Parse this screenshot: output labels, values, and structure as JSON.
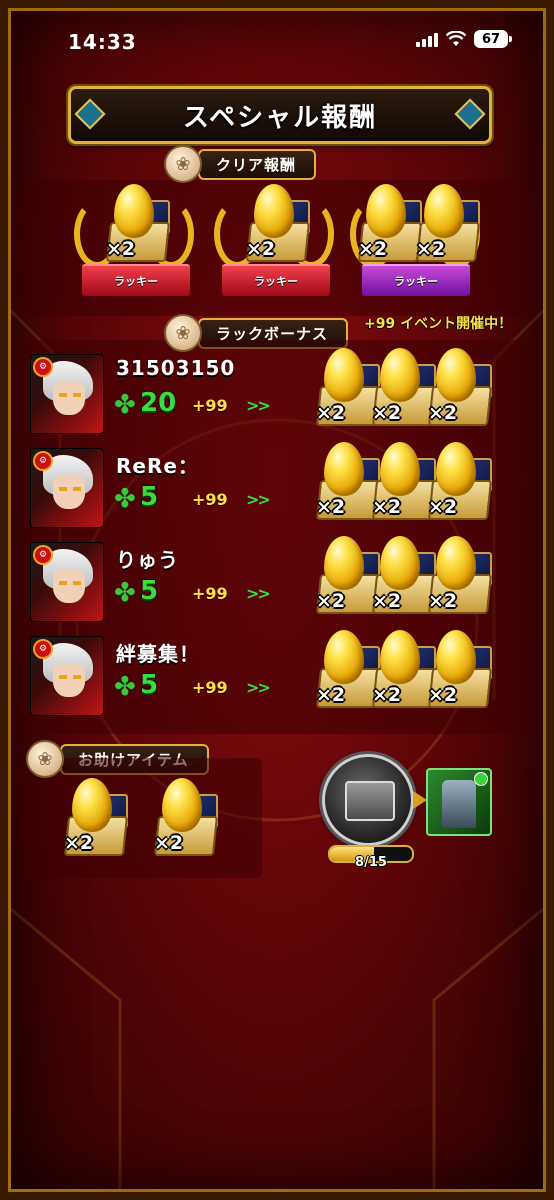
{
  "status_bar": {
    "time": "14:33",
    "battery": "67"
  },
  "title": "スペシャル報酬",
  "clear_reward": {
    "label": "クリア報酬",
    "groups": [
      {
        "ribbon": "ラッキー",
        "ribbon_color": "#c8102e",
        "counts": [
          "×2"
        ]
      },
      {
        "ribbon": "ラッキー",
        "ribbon_color": "#c8102e",
        "counts": [
          "×2"
        ]
      },
      {
        "ribbon": "ラッキー",
        "ribbon_color": "#9c1fc4",
        "counts": [
          "×2",
          "×2"
        ]
      }
    ]
  },
  "luck_bonus": {
    "label": "ラックボーナス",
    "event_note": "+99 イベント開催中！",
    "players": [
      {
        "name": "31503150",
        "luck": "20",
        "bonus": "+99",
        "arrow": ">>",
        "rewards": [
          "×2",
          "×2",
          "×2"
        ]
      },
      {
        "name": "ReRe：",
        "luck": "5",
        "bonus": "+99",
        "arrow": ">>",
        "rewards": [
          "×2",
          "×2",
          "×2"
        ]
      },
      {
        "name": "りゅう",
        "luck": "5",
        "bonus": "+99",
        "arrow": ">>",
        "rewards": [
          "×2",
          "×2",
          "×2"
        ]
      },
      {
        "name": "絆募集！",
        "luck": "5",
        "bonus": "+99",
        "arrow": ">>",
        "rewards": [
          "×2",
          "×2",
          "×2"
        ]
      }
    ]
  },
  "helper_items": {
    "label": "お助けアイテム",
    "counts": [
      "×2",
      "×2"
    ]
  },
  "treasure": {
    "progress_text": "8/15",
    "progress_fraction": 0.533
  },
  "icons": {
    "medal": "rose-medal-icon",
    "clover": "clover-icon",
    "egg": "golden-egg-icon",
    "treasure": "treasure-chest-icon"
  }
}
